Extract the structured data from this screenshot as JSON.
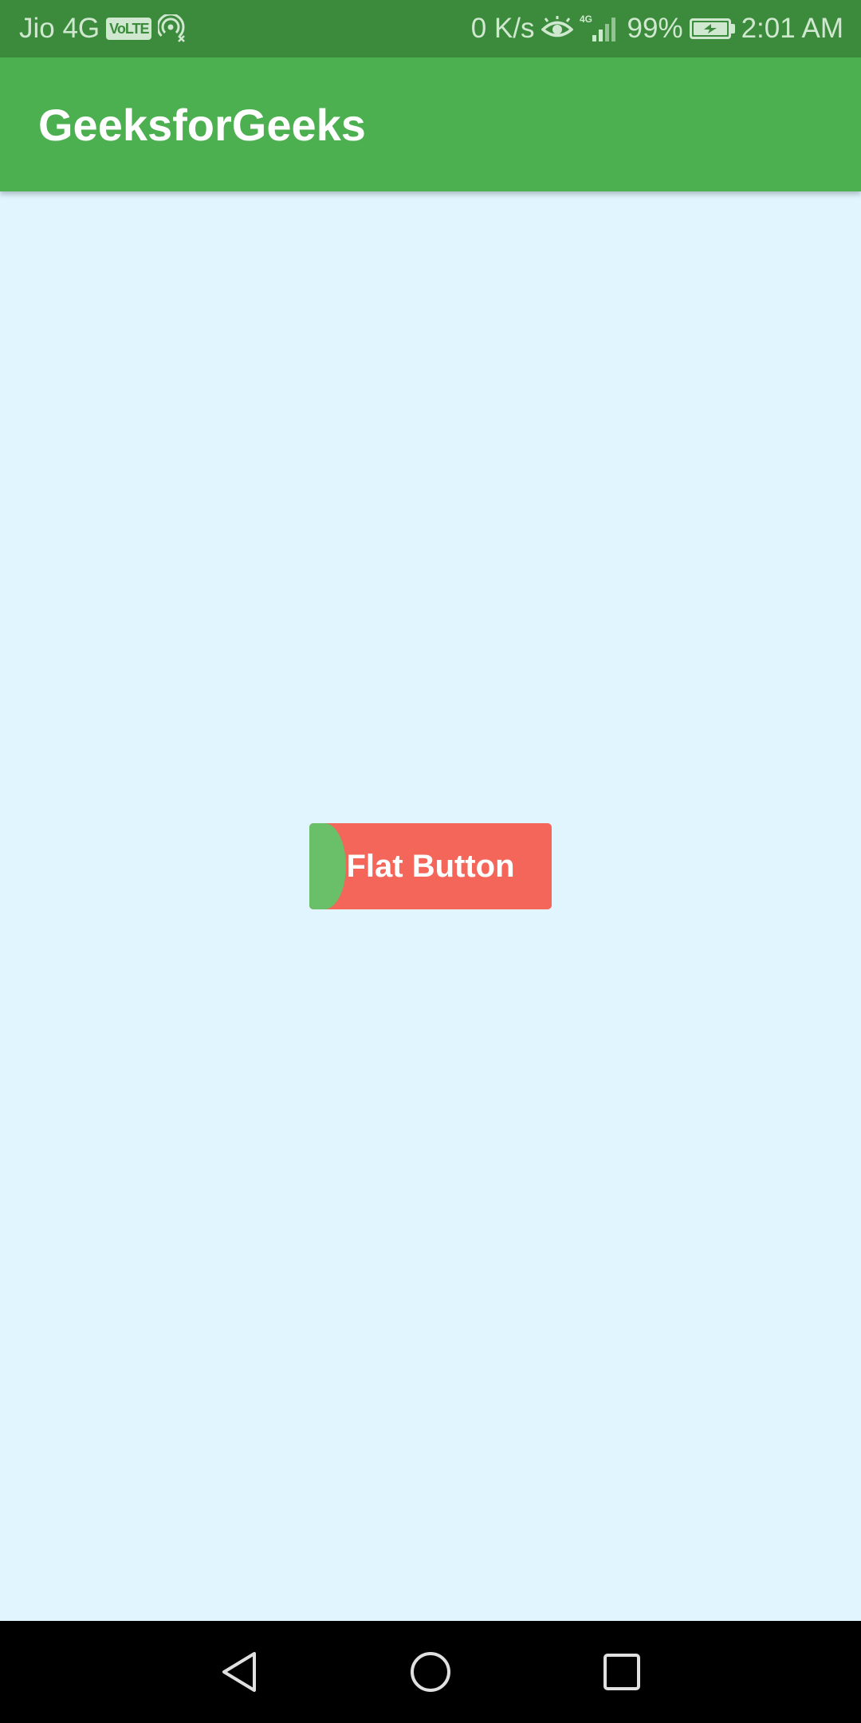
{
  "status_bar": {
    "carrier": "Jio 4G",
    "volte": "VoLTE",
    "net_speed": "0 K/s",
    "network_type": "4G",
    "battery": "99%",
    "time": "2:01 AM",
    "icons": [
      "volte-icon",
      "hotspot-icon",
      "eye-icon",
      "signal-icon",
      "battery-charging-icon"
    ]
  },
  "app_bar": {
    "title": "GeeksforGeeks"
  },
  "main": {
    "button_label": "Flat Button"
  },
  "nav_bar": {
    "icons": [
      "back-icon",
      "home-icon",
      "recents-icon"
    ]
  },
  "colors": {
    "status_bar": "#3c8b3c",
    "app_bar": "#4caf50",
    "background": "#e1f5fe",
    "button": "#f4655a",
    "button_splash": "#6abf69",
    "nav_bar": "#000000"
  }
}
